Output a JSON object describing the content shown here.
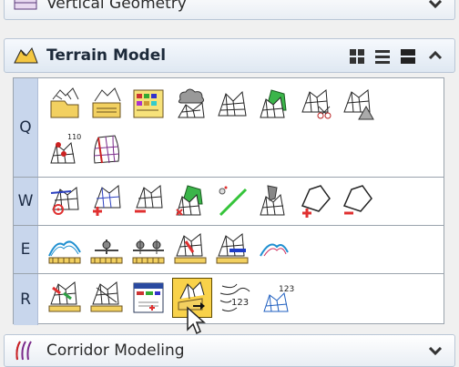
{
  "panels": {
    "vertical_geometry": {
      "title": "Vertical Geometry",
      "icon": "vertical-geometry-icon",
      "state": "collapsed"
    },
    "terrain_model": {
      "title": "Terrain Model",
      "icon": "terrain-model-icon",
      "state": "expanded"
    },
    "corridor_modeling": {
      "title": "Corridor Modeling",
      "icon": "corridor-modeling-icon",
      "state": "collapsed"
    }
  },
  "view_modes": [
    "grid-view-icon",
    "list-view-icon",
    "detail-view-icon"
  ],
  "rows": [
    {
      "letter": "Q",
      "tools": [
        "create-terrain-from-file-icon",
        "create-terrain-from-elements-icon",
        "create-terrain-from-graphical-filter-icon",
        "create-terrain-from-point-cloud-icon",
        "create-terrain-by-text-import-icon",
        "create-complex-terrain-icon",
        "clip-terrain-icon",
        "create-terrain-from-surface-icon",
        "create-terrain-by-elevation-points-icon",
        "create-terrain-model-from-mesh-icon"
      ]
    },
    {
      "letter": "W",
      "tools": [
        "add-feature-icon",
        "add-point-icon",
        "delete-feature-icon",
        "edit-feature-icon",
        "add-breakline-icon",
        "drop-point-icon",
        "insert-vertex-icon",
        "delete-vertex-icon"
      ]
    },
    {
      "letter": "E",
      "tools": [
        "analyze-terrain-icon",
        "analyze-point-icon",
        "analyze-between-points-icon",
        "analyze-drainage-icon",
        "analyze-slope-icon",
        "profile-terrain-icon"
      ]
    },
    {
      "letter": "R",
      "tools": [
        "label-triangle-icon",
        "label-mesh-icon",
        "terrain-report-icon",
        "export-terrain-icon",
        "contour-label-icon",
        "label-elevation-icon"
      ],
      "active_index": 3
    }
  ],
  "text_numbers": {
    "tool_label_110": "110",
    "tool_label_123a": "123",
    "tool_label_123b": "123"
  }
}
